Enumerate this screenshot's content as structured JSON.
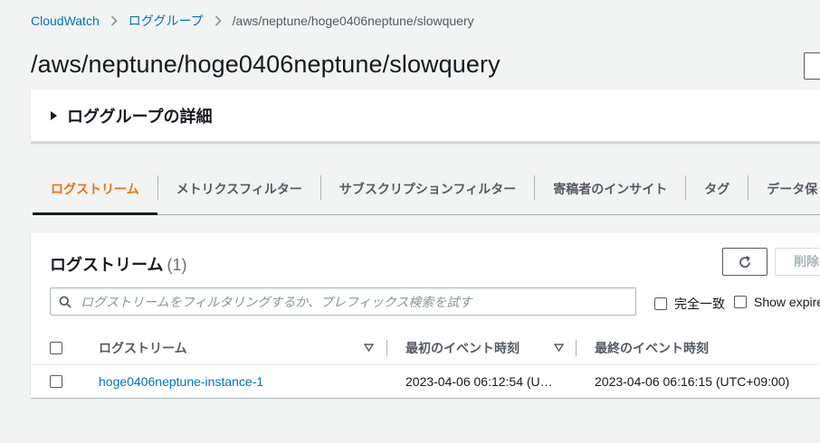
{
  "breadcrumb": {
    "items": [
      "CloudWatch",
      "ロググループ",
      "/aws/neptune/hoge0406neptune/slowquery"
    ]
  },
  "page": {
    "title": "/aws/neptune/hoge0406neptune/slowquery"
  },
  "details": {
    "title": "ロググループの詳細"
  },
  "tabs": [
    {
      "label": "ログストリーム",
      "active": true
    },
    {
      "label": "メトリクスフィルター"
    },
    {
      "label": "サブスクリプションフィルター"
    },
    {
      "label": "寄稿者のインサイト"
    },
    {
      "label": "タグ"
    },
    {
      "label": "データ保"
    }
  ],
  "streams": {
    "title": "ログストリーム",
    "count": "(1)",
    "delete_label": "削除",
    "search_placeholder": "ログストリームをフィルタリングするか、プレフィックス検索を試す",
    "exact_match_label": "完全一致",
    "show_expired_label": "Show expire",
    "columns": {
      "name": "ログストリーム",
      "first_event": "最初のイベント時刻",
      "last_event": "最終のイベント時刻"
    },
    "rows": [
      {
        "name": "hoge0406neptune-instance-1",
        "first_event": "2023-04-06 06:12:54 (U…",
        "last_event": "2023-04-06 06:16:15 (UTC+09:00)"
      }
    ]
  },
  "colors": {
    "accent": "#ec7211",
    "link": "#0073bb",
    "background": "#f2f3f3"
  },
  "icons": {
    "breadcrumb_separator": "chevron-right-icon",
    "details_toggle": "caret-right-icon",
    "refresh": "refresh-icon",
    "search": "search-icon",
    "sort": "sort-down-icon"
  }
}
